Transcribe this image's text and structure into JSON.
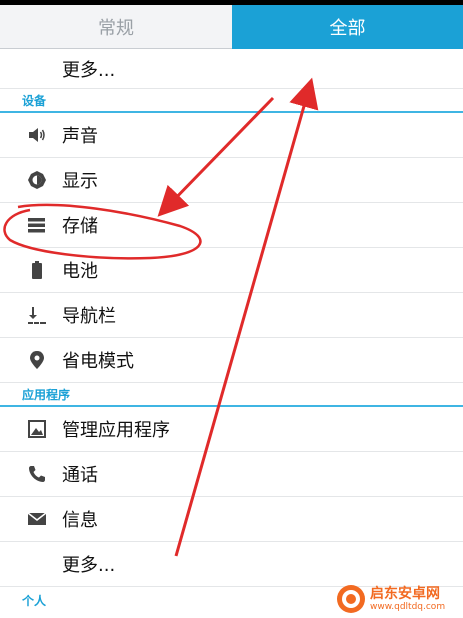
{
  "tabs": {
    "general": "常规",
    "all": "全部"
  },
  "list": {
    "more_top": "更多...",
    "section_device": "设备",
    "sound": "声音",
    "display": "显示",
    "storage": "存储",
    "battery": "电池",
    "navbar": "导航栏",
    "power_saving": "省电模式",
    "section_apps": "应用程序",
    "manage_apps": "管理应用程序",
    "calls": "通话",
    "messages": "信息",
    "more_bottom": "更多...",
    "section_personal": "个人"
  },
  "icons": {
    "sound": "speaker-icon",
    "display": "brightness-icon",
    "storage": "storage-icon",
    "battery": "battery-icon",
    "navbar": "navigation-bar-icon",
    "power_saving": "location-pin-icon",
    "manage_apps": "image-icon",
    "calls": "phone-icon",
    "messages": "envelope-icon"
  },
  "colors": {
    "accent": "#1ba1d6",
    "annotation": "#e02a2a",
    "watermark": "#f26a21"
  },
  "watermark": {
    "title": "启东安卓网",
    "url": "www.qdltdq.com"
  }
}
